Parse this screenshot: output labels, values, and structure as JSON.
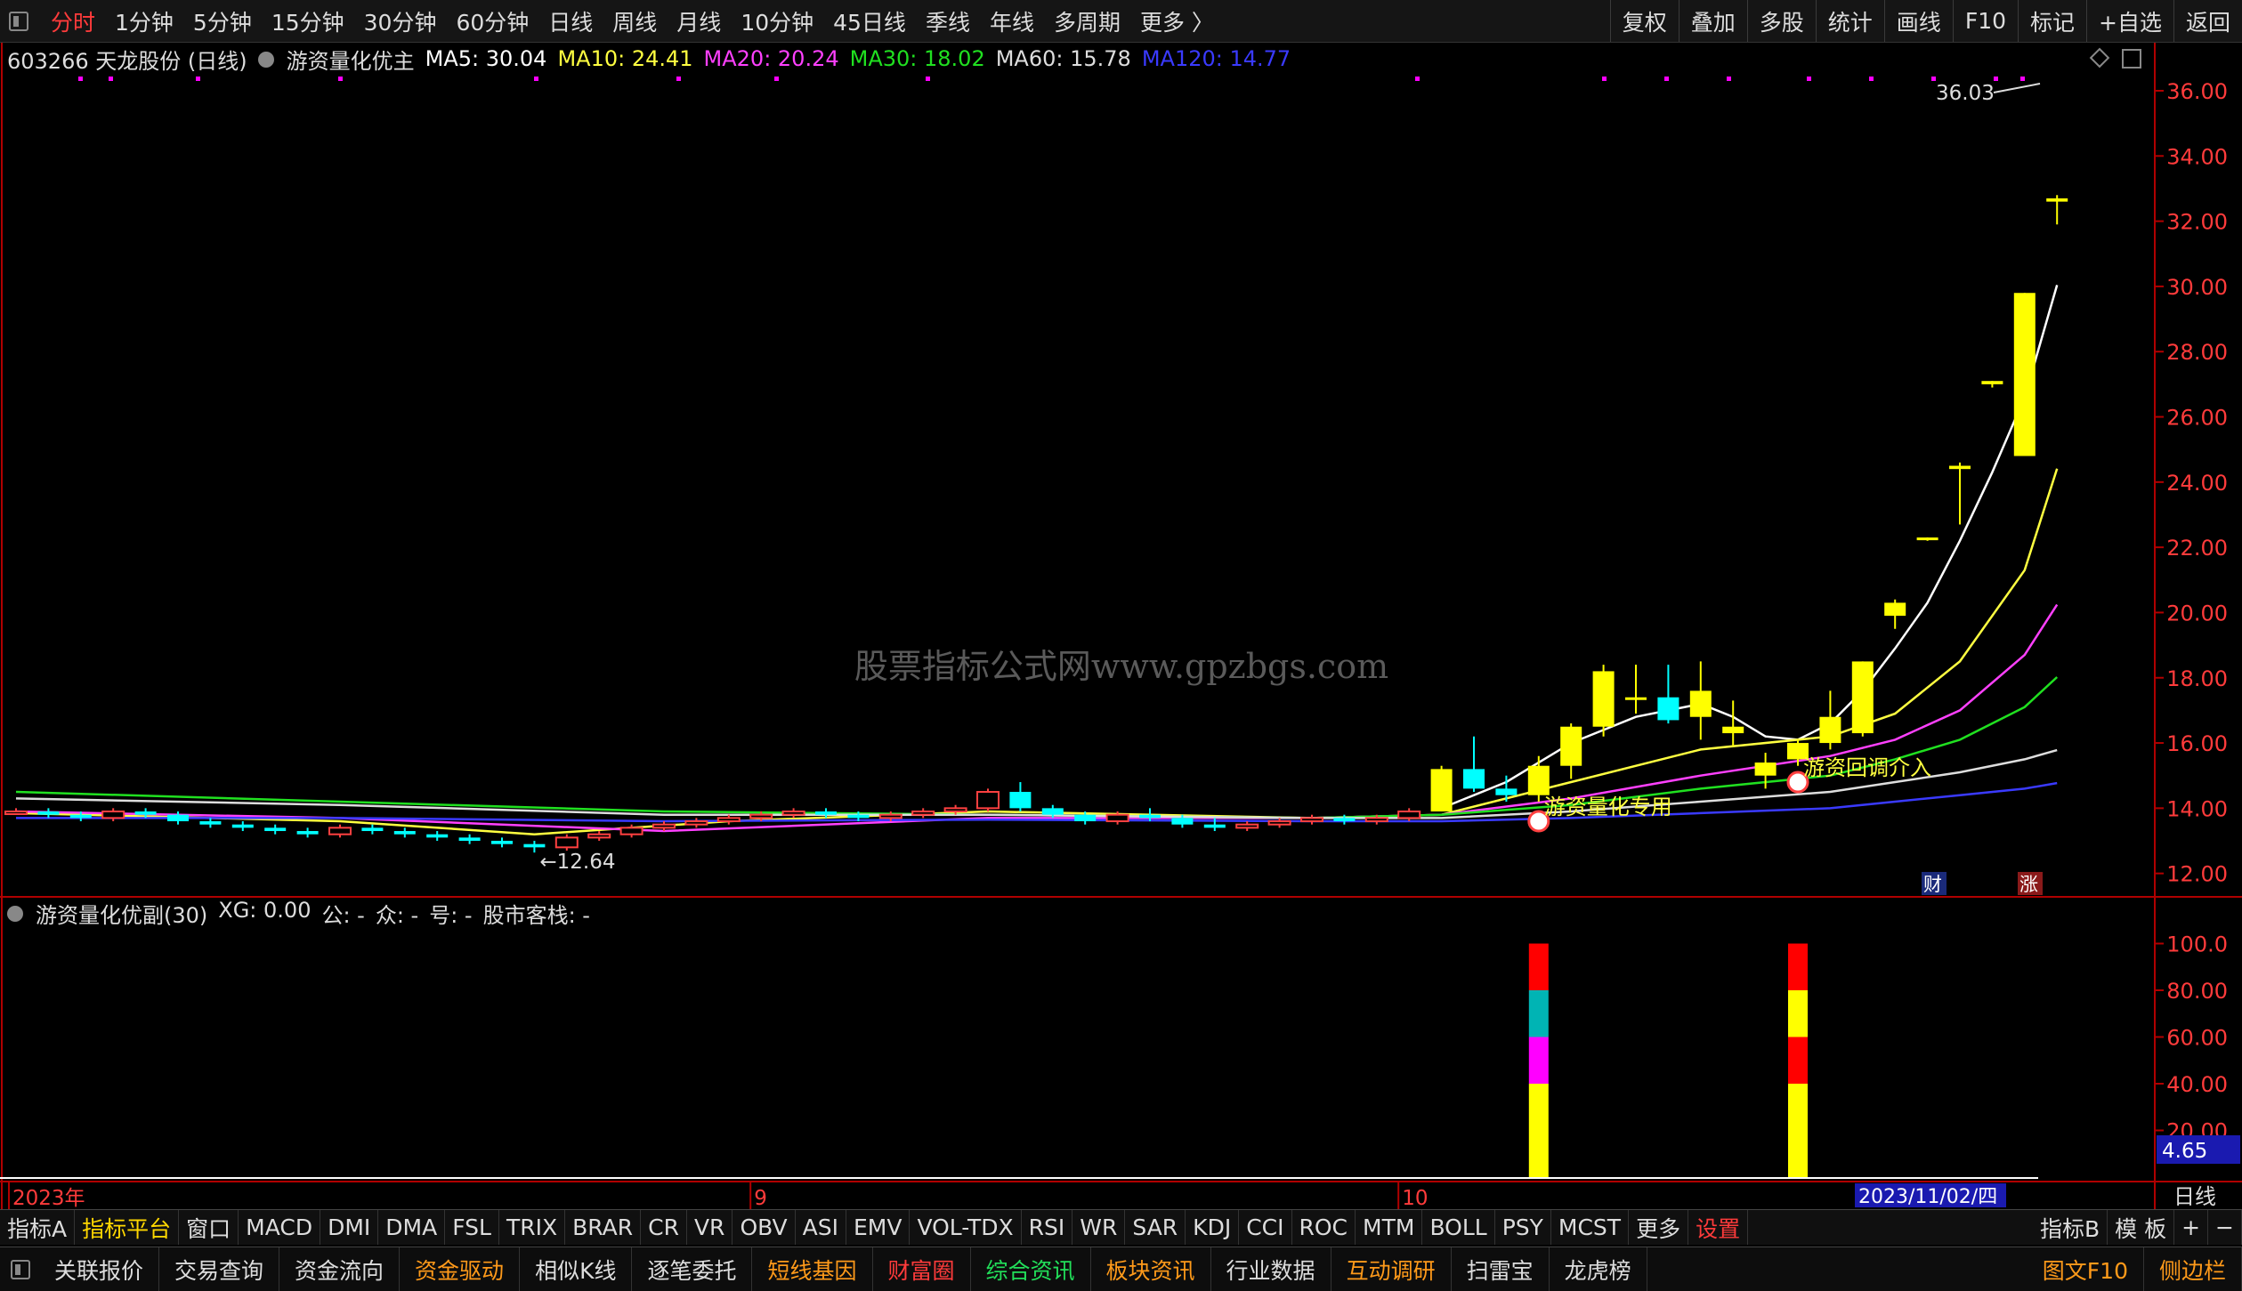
{
  "topbar": {
    "periods": [
      "分时",
      "1分钟",
      "5分钟",
      "15分钟",
      "30分钟",
      "60分钟",
      "日线",
      "周线",
      "月线",
      "10分钟",
      "45日线",
      "季线",
      "年线",
      "多周期",
      "更多 〉"
    ],
    "active_index": 0,
    "right_buttons": [
      "复权",
      "叠加",
      "多股",
      "统计",
      "画线",
      "F10",
      "标记",
      "+自选",
      "返回"
    ]
  },
  "info": {
    "stock": "603266 天龙股份 (日线)",
    "indicator": "游资量化优主",
    "ma": [
      {
        "text": "MA5: 30.04",
        "color": "#ffffff"
      },
      {
        "text": "MA10: 24.41",
        "color": "#ffff40"
      },
      {
        "text": "MA20: 20.24",
        "color": "#ff40ff"
      },
      {
        "text": "MA30: 18.02",
        "color": "#20e020"
      },
      {
        "text": "MA60: 15.78",
        "color": "#dddddd"
      },
      {
        "text": "MA120: 14.77",
        "color": "#3a3aff"
      }
    ]
  },
  "sub_info": {
    "title": "游资量化优副(30)",
    "items": [
      "XG: 0.00",
      "公: -",
      "众: -",
      "号: -",
      "股市客栈: -"
    ]
  },
  "watermark": "股票指标公式网www.gpzbgs.com",
  "chart_data": {
    "type": "candlestick",
    "price_axis": {
      "min": 11.5,
      "max": 36.6,
      "ticks": [
        "12.00",
        "14.00",
        "16.00",
        "18.00",
        "20.00",
        "22.00",
        "24.00",
        "26.00",
        "28.00",
        "30.00",
        "32.00",
        "34.00",
        "36.00"
      ]
    },
    "sub_axis": {
      "min": 0,
      "max": 104,
      "ticks": [
        "20.00",
        "40.00",
        "60.00",
        "80.00",
        "100.0"
      ],
      "current_value": "4.65"
    },
    "x_labels": [
      {
        "text": "2023年",
        "i": 0,
        "color": "#ff3b3b"
      },
      {
        "text": "9",
        "i": 23
      },
      {
        "text": "10",
        "i": 43
      }
    ],
    "cursor_date": "2023/11/02/四",
    "period_label": "日线",
    "annotations": {
      "low": "←12.64",
      "high": "36.03",
      "signal1": "游资量化专用",
      "signal2": "游资回调介入",
      "badge_cai": "财",
      "badge_zhang": "涨"
    },
    "candles": [
      [
        13.9,
        14.0,
        13.8,
        13.9
      ],
      [
        13.9,
        14.0,
        13.7,
        13.8
      ],
      [
        13.8,
        13.9,
        13.6,
        13.7
      ],
      [
        13.7,
        14.0,
        13.6,
        13.9
      ],
      [
        13.9,
        14.0,
        13.7,
        13.8
      ],
      [
        13.8,
        13.9,
        13.5,
        13.6
      ],
      [
        13.6,
        13.7,
        13.4,
        13.5
      ],
      [
        13.5,
        13.6,
        13.3,
        13.4
      ],
      [
        13.4,
        13.5,
        13.2,
        13.3
      ],
      [
        13.3,
        13.4,
        13.1,
        13.2
      ],
      [
        13.2,
        13.5,
        13.1,
        13.4
      ],
      [
        13.4,
        13.5,
        13.2,
        13.3
      ],
      [
        13.3,
        13.4,
        13.1,
        13.2
      ],
      [
        13.2,
        13.3,
        13.0,
        13.1
      ],
      [
        13.1,
        13.2,
        12.9,
        13.0
      ],
      [
        13.0,
        13.1,
        12.8,
        12.9
      ],
      [
        12.9,
        13.0,
        12.64,
        12.8
      ],
      [
        12.8,
        13.2,
        12.7,
        13.1
      ],
      [
        13.1,
        13.3,
        13.0,
        13.2
      ],
      [
        13.2,
        13.5,
        13.1,
        13.4
      ],
      [
        13.4,
        13.6,
        13.3,
        13.5
      ],
      [
        13.5,
        13.7,
        13.4,
        13.6
      ],
      [
        13.6,
        13.8,
        13.5,
        13.7
      ],
      [
        13.7,
        13.9,
        13.6,
        13.8
      ],
      [
        13.8,
        14.0,
        13.7,
        13.9
      ],
      [
        13.9,
        14.0,
        13.7,
        13.8
      ],
      [
        13.8,
        13.9,
        13.6,
        13.7
      ],
      [
        13.7,
        13.9,
        13.6,
        13.8
      ],
      [
        13.8,
        14.0,
        13.7,
        13.9
      ],
      [
        13.9,
        14.1,
        13.8,
        14.0
      ],
      [
        14.0,
        14.6,
        13.9,
        14.5
      ],
      [
        14.5,
        14.8,
        13.9,
        14.0
      ],
      [
        14.0,
        14.1,
        13.7,
        13.8
      ],
      [
        13.8,
        13.9,
        13.5,
        13.6
      ],
      [
        13.6,
        13.9,
        13.5,
        13.8
      ],
      [
        13.8,
        14.0,
        13.6,
        13.7
      ],
      [
        13.7,
        13.8,
        13.4,
        13.5
      ],
      [
        13.5,
        13.7,
        13.3,
        13.4
      ],
      [
        13.4,
        13.6,
        13.3,
        13.5
      ],
      [
        13.5,
        13.7,
        13.4,
        13.6
      ],
      [
        13.6,
        13.8,
        13.5,
        13.7
      ],
      [
        13.7,
        13.8,
        13.5,
        13.6
      ],
      [
        13.6,
        13.8,
        13.5,
        13.7
      ],
      [
        13.7,
        14.0,
        13.6,
        13.9
      ],
      [
        13.9,
        15.3,
        13.9,
        15.2
      ],
      [
        15.2,
        16.2,
        14.5,
        14.6
      ],
      [
        14.6,
        15.0,
        14.2,
        14.4
      ],
      [
        14.4,
        15.6,
        14.2,
        15.3
      ],
      [
        15.3,
        16.6,
        14.9,
        16.5
      ],
      [
        16.5,
        18.4,
        16.2,
        18.2
      ],
      [
        17.4,
        18.4,
        16.9,
        17.4
      ],
      [
        17.4,
        18.4,
        16.6,
        16.7
      ],
      [
        16.8,
        18.5,
        16.1,
        17.6
      ],
      [
        16.3,
        17.3,
        15.9,
        16.5
      ],
      [
        15.0,
        15.7,
        14.6,
        15.4
      ],
      [
        15.5,
        16.1,
        15.3,
        16.0
      ],
      [
        16.0,
        17.6,
        15.8,
        16.8
      ],
      [
        16.3,
        18.5,
        16.2,
        18.5
      ],
      [
        19.9,
        20.4,
        19.5,
        20.3
      ],
      [
        22.3,
        22.3,
        22.2,
        22.3
      ],
      [
        24.4,
        24.6,
        22.7,
        24.5
      ],
      [
        27.0,
        27.1,
        26.9,
        27.1
      ],
      [
        24.8,
        29.8,
        24.8,
        29.8
      ],
      [
        32.6,
        32.8,
        31.9,
        32.7
      ]
    ],
    "sub_bars": [
      {
        "i": 47,
        "segments": [
          {
            "from": 0,
            "to": 40,
            "color": "#ffff00"
          },
          {
            "from": 40,
            "to": 60,
            "color": "#ff00ff"
          },
          {
            "from": 60,
            "to": 80,
            "color": "#00b4b4"
          },
          {
            "from": 80,
            "to": 100,
            "color": "#ff0000"
          }
        ]
      },
      {
        "i": 55,
        "segments": [
          {
            "from": 0,
            "to": 40,
            "color": "#ffff00"
          },
          {
            "from": 40,
            "to": 60,
            "color": "#ff0000"
          },
          {
            "from": 60,
            "to": 80,
            "color": "#ffff00"
          },
          {
            "from": 80,
            "to": 100,
            "color": "#ff0000"
          }
        ]
      }
    ],
    "ma_series": [
      {
        "name": "MA5",
        "color": "#ffffff",
        "values": [
          [
            44,
            14.0
          ],
          [
            46,
            14.8
          ],
          [
            48,
            16.0
          ],
          [
            50,
            16.8
          ],
          [
            52,
            17.2
          ],
          [
            53,
            16.8
          ],
          [
            54,
            16.2
          ],
          [
            55,
            16.1
          ],
          [
            56,
            16.6
          ],
          [
            57,
            17.6
          ],
          [
            58,
            18.9
          ],
          [
            59,
            20.3
          ],
          [
            60,
            22.2
          ],
          [
            61,
            24.3
          ],
          [
            62,
            26.6
          ],
          [
            63,
            30.04
          ]
        ]
      },
      {
        "name": "MA10",
        "color": "#ffff40",
        "values": [
          [
            0,
            13.85
          ],
          [
            10,
            13.6
          ],
          [
            16,
            13.2
          ],
          [
            22,
            13.6
          ],
          [
            30,
            13.9
          ],
          [
            40,
            13.7
          ],
          [
            44,
            13.8
          ],
          [
            48,
            14.8
          ],
          [
            52,
            15.8
          ],
          [
            56,
            16.2
          ],
          [
            58,
            16.9
          ],
          [
            60,
            18.5
          ],
          [
            62,
            21.3
          ],
          [
            63,
            24.41
          ]
        ]
      },
      {
        "name": "MA20",
        "color": "#ff40ff",
        "values": [
          [
            0,
            13.9
          ],
          [
            10,
            13.7
          ],
          [
            20,
            13.3
          ],
          [
            30,
            13.7
          ],
          [
            40,
            13.7
          ],
          [
            44,
            13.8
          ],
          [
            48,
            14.3
          ],
          [
            52,
            15.0
          ],
          [
            56,
            15.6
          ],
          [
            58,
            16.1
          ],
          [
            60,
            17.0
          ],
          [
            62,
            18.7
          ],
          [
            63,
            20.24
          ]
        ]
      },
      {
        "name": "MA30",
        "color": "#20e020",
        "values": [
          [
            0,
            14.5
          ],
          [
            10,
            14.2
          ],
          [
            20,
            13.9
          ],
          [
            30,
            13.8
          ],
          [
            40,
            13.7
          ],
          [
            44,
            13.8
          ],
          [
            48,
            14.1
          ],
          [
            52,
            14.6
          ],
          [
            56,
            15.0
          ],
          [
            58,
            15.5
          ],
          [
            60,
            16.1
          ],
          [
            62,
            17.1
          ],
          [
            63,
            18.02
          ]
        ]
      },
      {
        "name": "MA60",
        "color": "#dddddd",
        "values": [
          [
            0,
            14.3
          ],
          [
            10,
            14.1
          ],
          [
            20,
            13.8
          ],
          [
            30,
            13.8
          ],
          [
            40,
            13.7
          ],
          [
            44,
            13.7
          ],
          [
            48,
            13.9
          ],
          [
            52,
            14.2
          ],
          [
            56,
            14.5
          ],
          [
            58,
            14.8
          ],
          [
            60,
            15.1
          ],
          [
            62,
            15.5
          ],
          [
            63,
            15.78
          ]
        ]
      },
      {
        "name": "MA120",
        "color": "#3a3aff",
        "values": [
          [
            0,
            13.7
          ],
          [
            10,
            13.7
          ],
          [
            20,
            13.6
          ],
          [
            30,
            13.65
          ],
          [
            40,
            13.6
          ],
          [
            44,
            13.6
          ],
          [
            48,
            13.7
          ],
          [
            52,
            13.85
          ],
          [
            56,
            14.0
          ],
          [
            58,
            14.2
          ],
          [
            60,
            14.4
          ],
          [
            62,
            14.6
          ],
          [
            63,
            14.77
          ]
        ]
      }
    ]
  },
  "indicator_tabs": [
    "指标A",
    "指标平台",
    "窗口",
    "MACD",
    "DMI",
    "DMA",
    "FSL",
    "TRIX",
    "BRAR",
    "CR",
    "VR",
    "OBV",
    "ASI",
    "EMV",
    "VOL-TDX",
    "RSI",
    "WR",
    "SAR",
    "KDJ",
    "CCI",
    "ROC",
    "MTM",
    "BOLL",
    "PSY",
    "MCST",
    "更多",
    "设置"
  ],
  "indicator_right": [
    "指标B",
    "模 板",
    "+",
    "−"
  ],
  "bottom_buttons": [
    {
      "label": "关联报价",
      "color": "#dddddd"
    },
    {
      "label": "交易查询",
      "color": "#dddddd"
    },
    {
      "label": "资金流向",
      "color": "#dddddd"
    },
    {
      "label": "资金驱动",
      "color": "#ff9a1a"
    },
    {
      "label": "相似K线",
      "color": "#dddddd"
    },
    {
      "label": "逐笔委托",
      "color": "#dddddd"
    },
    {
      "label": "短线基因",
      "color": "#ff9a1a"
    },
    {
      "label": "财富圈",
      "color": "#ff3b3b"
    },
    {
      "label": "综合资讯",
      "color": "#22e05a"
    },
    {
      "label": "板块资讯",
      "color": "#ff9a1a"
    },
    {
      "label": "行业数据",
      "color": "#dddddd"
    },
    {
      "label": "互动调研",
      "color": "#ff9a1a"
    },
    {
      "label": "扫雷宝",
      "color": "#dddddd"
    },
    {
      "label": "龙虎榜",
      "color": "#dddddd"
    }
  ],
  "bottom_right": [
    "图文F10",
    "侧边栏"
  ]
}
